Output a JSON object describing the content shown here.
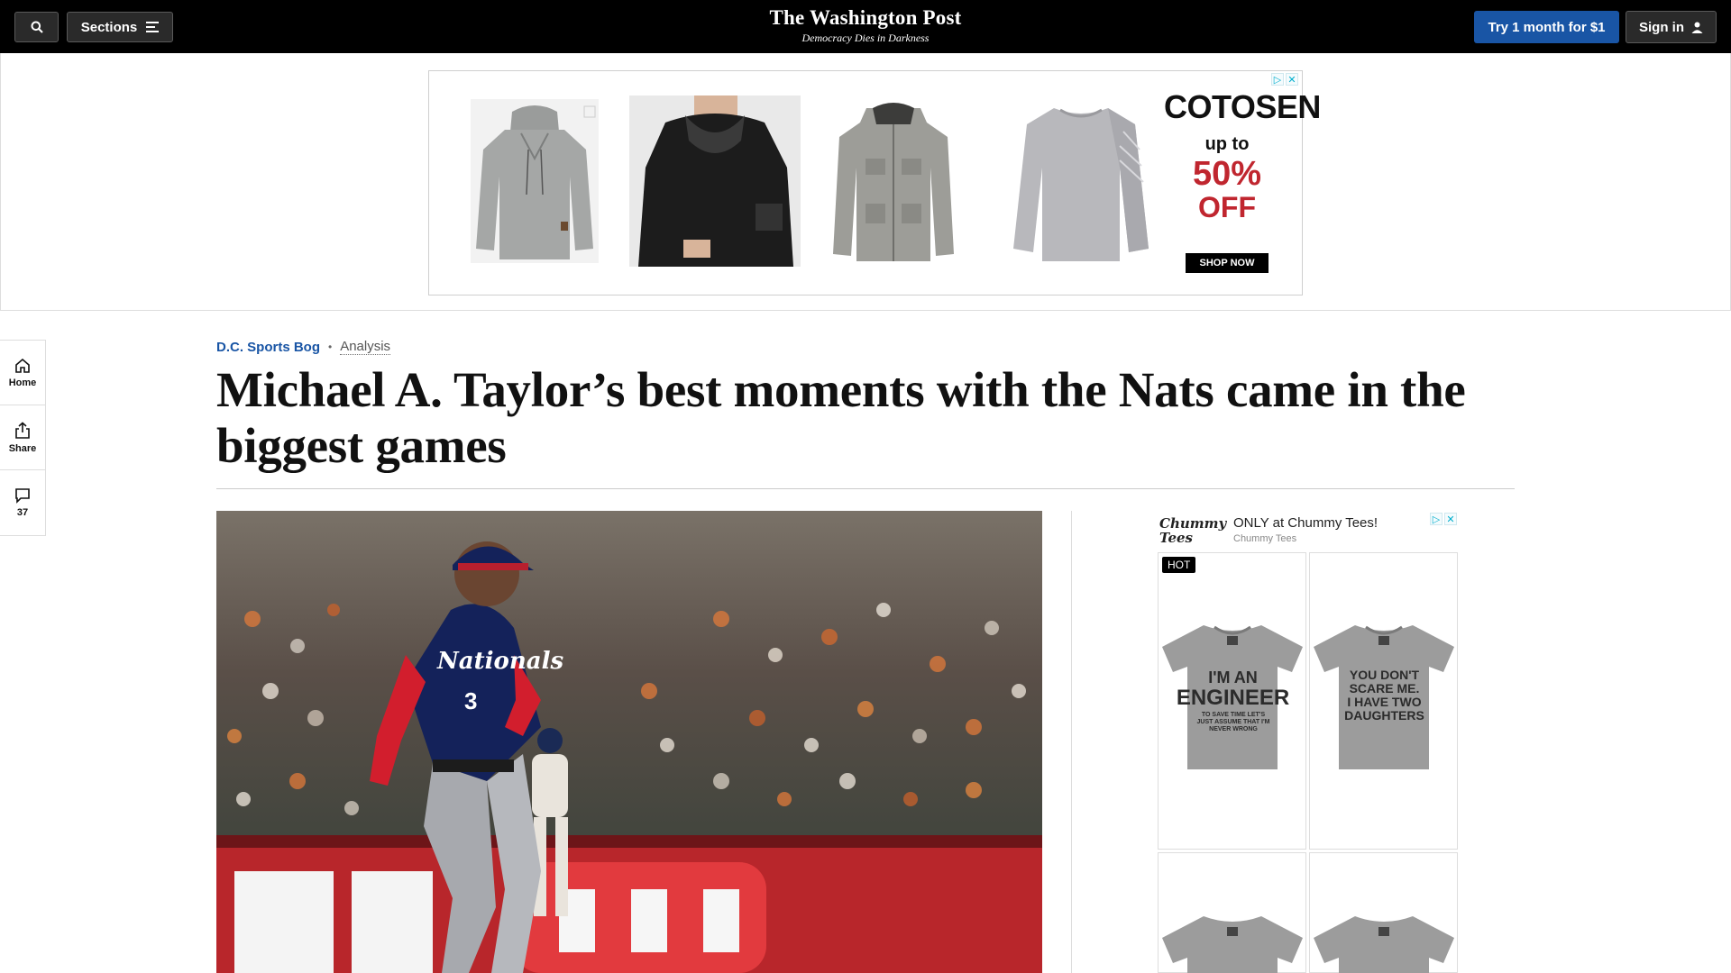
{
  "header": {
    "sections_label": "Sections",
    "logo": "The Washington Post",
    "tagline": "Democracy Dies in Darkness",
    "subscribe_label": "Try 1 month for $1",
    "signin_label": "Sign in"
  },
  "top_ad": {
    "brand": "COTOSEN",
    "up_to": "up to",
    "percent": "50%",
    "off": "OFF",
    "cta": "SHOP NOW"
  },
  "rail": {
    "home": "Home",
    "share": "Share",
    "comments_count": "37"
  },
  "article": {
    "section": "D.C. Sports Bog",
    "label": "Analysis",
    "headline": "Michael A. Taylor’s best moments with the Nats came in the biggest games"
  },
  "right_ad": {
    "brand": "Chummy Tees",
    "title": "ONLY at Chummy Tees!",
    "subtitle": "Chummy Tees",
    "badge": "HOT",
    "shirt1_line1": "I'M AN",
    "shirt1_line2": "ENGINEER",
    "shirt1_line3": "TO SAVE TIME LET'S JUST ASSUME THAT I'M NEVER WRONG",
    "shirt2_line1": "YOU DON'T",
    "shirt2_line2": "SCARE ME.",
    "shirt2_line3": "I HAVE TWO",
    "shirt2_line4": "DAUGHTERS"
  },
  "colors": {
    "accent_blue": "#1955a5",
    "sale_red": "#c0262f",
    "nationals_navy": "#14225a"
  }
}
